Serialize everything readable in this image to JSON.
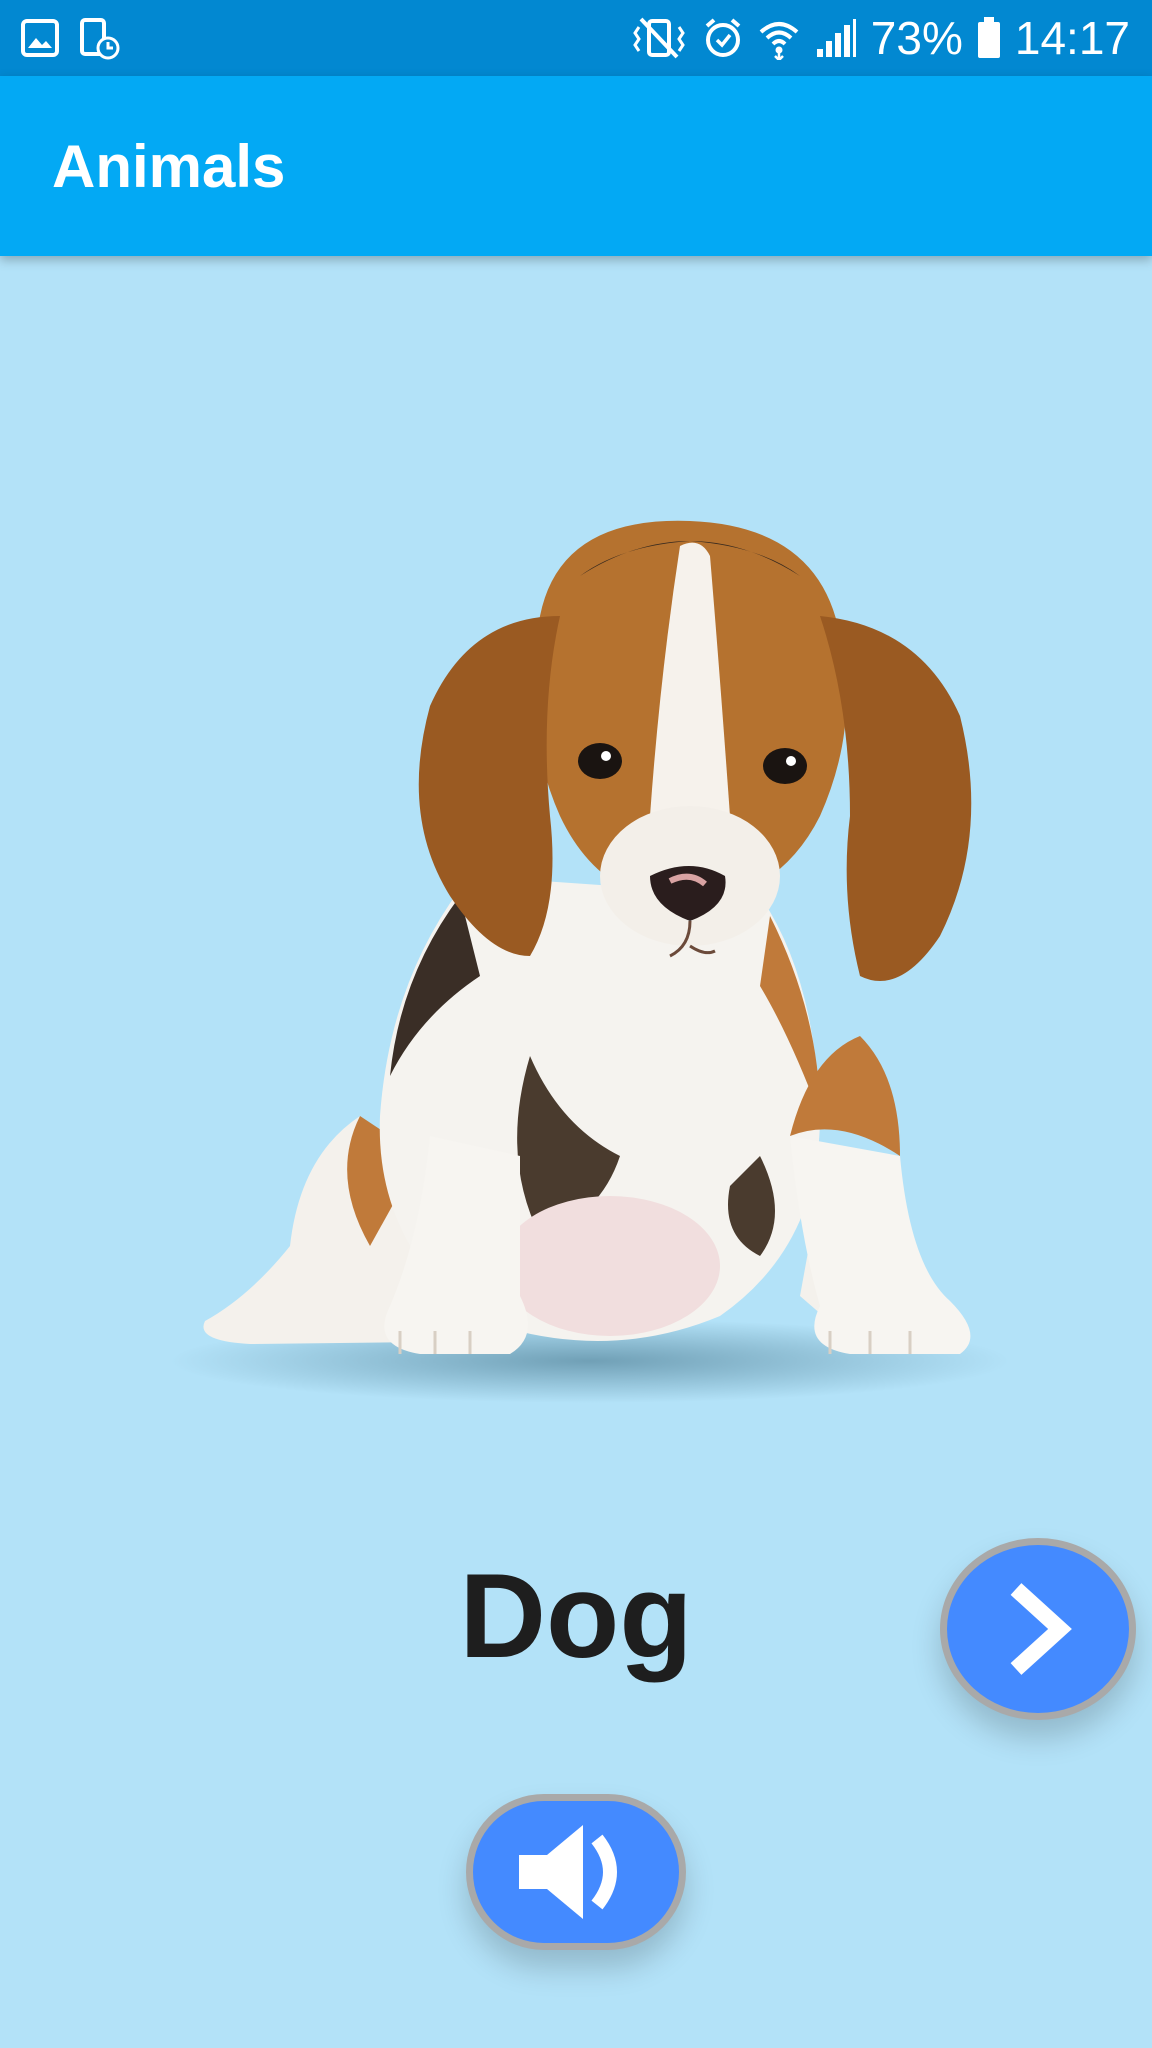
{
  "status_bar": {
    "battery_percent": "73%",
    "time": "14:17",
    "left_icons": [
      "gallery-notification-icon",
      "device-schedule-icon"
    ],
    "right_icons": [
      "vibrate-mute-icon",
      "alarm-icon",
      "wifi-icon",
      "cellular-signal-icon",
      "battery-icon"
    ]
  },
  "app_bar": {
    "title": "Animals",
    "color": "#03a9f4"
  },
  "card": {
    "animal_name": "Dog",
    "image_subject": "beagle-puppy",
    "background_color": "#b3e2f8"
  },
  "buttons": {
    "next_icon": "chevron-right-icon",
    "sound_icon": "speaker-icon",
    "button_color": "#448aff"
  }
}
